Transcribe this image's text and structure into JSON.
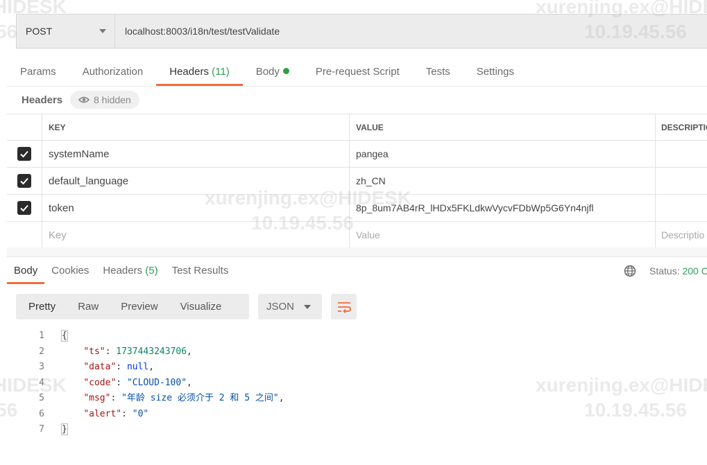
{
  "request": {
    "method": "POST",
    "url": "localhost:8003/i18n/test/testValidate"
  },
  "request_tabs": [
    {
      "label": "Params",
      "count": ""
    },
    {
      "label": "Authorization",
      "count": ""
    },
    {
      "label": "Headers",
      "count": "(11)"
    },
    {
      "label": "Body",
      "count": ""
    },
    {
      "label": "Pre-request Script",
      "count": ""
    },
    {
      "label": "Tests",
      "count": ""
    },
    {
      "label": "Settings",
      "count": ""
    }
  ],
  "headers_section": {
    "label": "Headers",
    "hidden_text": "8 hidden"
  },
  "table": {
    "columns": [
      "KEY",
      "VALUE",
      "DESCRIPTIO"
    ],
    "rows": [
      {
        "key": "systemName",
        "value": "pangea",
        "description": ""
      },
      {
        "key": "default_language",
        "value": "zh_CN",
        "description": ""
      },
      {
        "key": "token",
        "value": "8p_8um7AB4rR_lHDx5FKLdkwVycvFDbWp5G6Yn4njfl",
        "description": ""
      }
    ],
    "placeholders": {
      "key": "Key",
      "value": "Value",
      "description": "Descriptio"
    }
  },
  "response_tabs": [
    {
      "label": "Body",
      "count": ""
    },
    {
      "label": "Cookies",
      "count": ""
    },
    {
      "label": "Headers",
      "count": "(5)"
    },
    {
      "label": "Test Results",
      "count": ""
    }
  ],
  "status": {
    "label": "Status:",
    "value": "200 C"
  },
  "view_modes": [
    "Pretty",
    "Raw",
    "Preview",
    "Visualize"
  ],
  "format": "JSON",
  "code_lines": [
    "1",
    "2",
    "3",
    "4",
    "5",
    "6",
    "7"
  ],
  "response_json": {
    "ts_key": "\"ts\"",
    "ts_val": "1737443243706",
    "data_key": "\"data\"",
    "data_val": "null",
    "code_key": "\"code\"",
    "code_val": "\"CLOUD-100\"",
    "msg_key": "\"msg\"",
    "msg_val": "\"年龄 size 必须介于 2 和 5 之间\"",
    "alert_key": "\"alert\"",
    "alert_val": "\"0\""
  },
  "watermarks": {
    "user": "xurenjing.ex@HIDESK",
    "ip": "10.19.45.56",
    "short": "HIDESK",
    "ip_short": "56"
  },
  "colors": {
    "accent": "#f26b3a",
    "green": "#2f9e57"
  }
}
